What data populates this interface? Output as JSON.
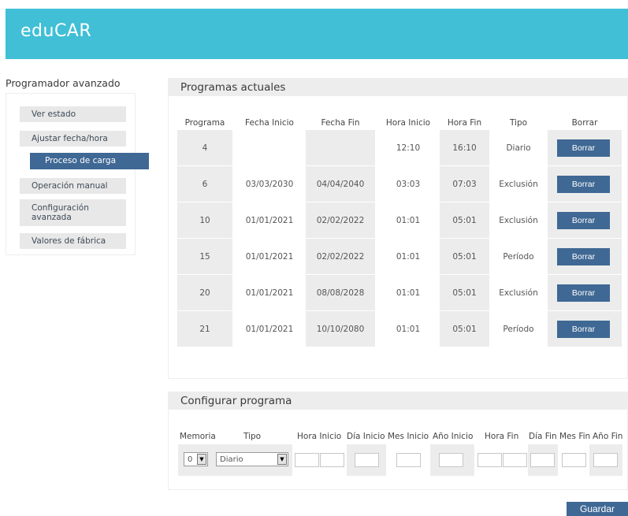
{
  "app": {
    "brand": "eduCAR"
  },
  "sidebar": {
    "title": "Programador avanzado",
    "items": [
      {
        "label": "Ver estado"
      },
      {
        "label": "Ajustar fecha/hora"
      },
      {
        "label": "Proceso de carga"
      },
      {
        "label": "Operación manual"
      },
      {
        "label": "Configuración avanzada"
      },
      {
        "label": "Valores de fábrica"
      }
    ]
  },
  "programs": {
    "title": "Programas actuales",
    "headers": [
      "Programa",
      "Fecha Inicio",
      "Fecha Fin",
      "Hora Inicio",
      "Hora Fin",
      "Tipo",
      "Borrar"
    ],
    "rows": [
      {
        "programa": "4",
        "fecha_inicio": "",
        "fecha_fin": "",
        "hora_inicio": "12:10",
        "hora_fin": "16:10",
        "tipo": "Diario",
        "borrar": "Borrar"
      },
      {
        "programa": "6",
        "fecha_inicio": "03/03/2030",
        "fecha_fin": "04/04/2040",
        "hora_inicio": "03:03",
        "hora_fin": "07:03",
        "tipo": "Exclusión",
        "borrar": "Borrar"
      },
      {
        "programa": "10",
        "fecha_inicio": "01/01/2021",
        "fecha_fin": "02/02/2022",
        "hora_inicio": "01:01",
        "hora_fin": "05:01",
        "tipo": "Exclusión",
        "borrar": "Borrar"
      },
      {
        "programa": "15",
        "fecha_inicio": "01/01/2021",
        "fecha_fin": "02/02/2022",
        "hora_inicio": "01:01",
        "hora_fin": "05:01",
        "tipo": "Período",
        "borrar": "Borrar"
      },
      {
        "programa": "20",
        "fecha_inicio": "01/01/2021",
        "fecha_fin": "08/08/2028",
        "hora_inicio": "01:01",
        "hora_fin": "05:01",
        "tipo": "Exclusión",
        "borrar": "Borrar"
      },
      {
        "programa": "21",
        "fecha_inicio": "01/01/2021",
        "fecha_fin": "10/10/2080",
        "hora_inicio": "01:01",
        "hora_fin": "05:01",
        "tipo": "Período",
        "borrar": "Borrar"
      }
    ]
  },
  "config": {
    "title": "Configurar programa",
    "headers": {
      "memoria": "Memoria",
      "tipo": "Tipo",
      "hora_inicio": "Hora Inicio",
      "dia_inicio": "Día Inicio",
      "mes_inicio": "Mes Inicio",
      "anio_inicio": "Año Inicio",
      "hora_fin": "Hora Fin",
      "dia_fin": "Día Fin",
      "mes_fin": "Mes Fin",
      "anio_fin": "Año Fin"
    },
    "memoria_value": "0",
    "tipo_value": "Diario",
    "save_label": "Guardar"
  }
}
